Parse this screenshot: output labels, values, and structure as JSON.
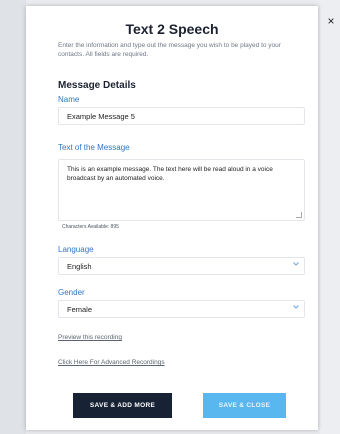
{
  "modal": {
    "title": "Text 2 Speech",
    "intro": "Enter the information and type out the message you wish to be played to your contacts. All fields are required.",
    "close_glyph": "×"
  },
  "section": {
    "title": "Message Details"
  },
  "fields": {
    "name_label": "Name",
    "name_value": "Example Message 5",
    "text_label": "Text of the Message",
    "text_value": "This is an example message. The text here will be read aloud in a voice broadcast by an automated voice.",
    "chars_available": "Characters Available: 895",
    "language_label": "Language",
    "language_value": "English",
    "gender_label": "Gender",
    "gender_value": "Female"
  },
  "links": {
    "preview": "Preview this recording",
    "advanced": "Click Here For Advanced Recordings"
  },
  "buttons": {
    "save_add": "SAVE & ADD MORE",
    "save_close": "SAVE & CLOSE"
  },
  "colors": {
    "label_blue": "#2f77c4",
    "dark_button": "#172235",
    "light_button": "#59b7f0"
  }
}
